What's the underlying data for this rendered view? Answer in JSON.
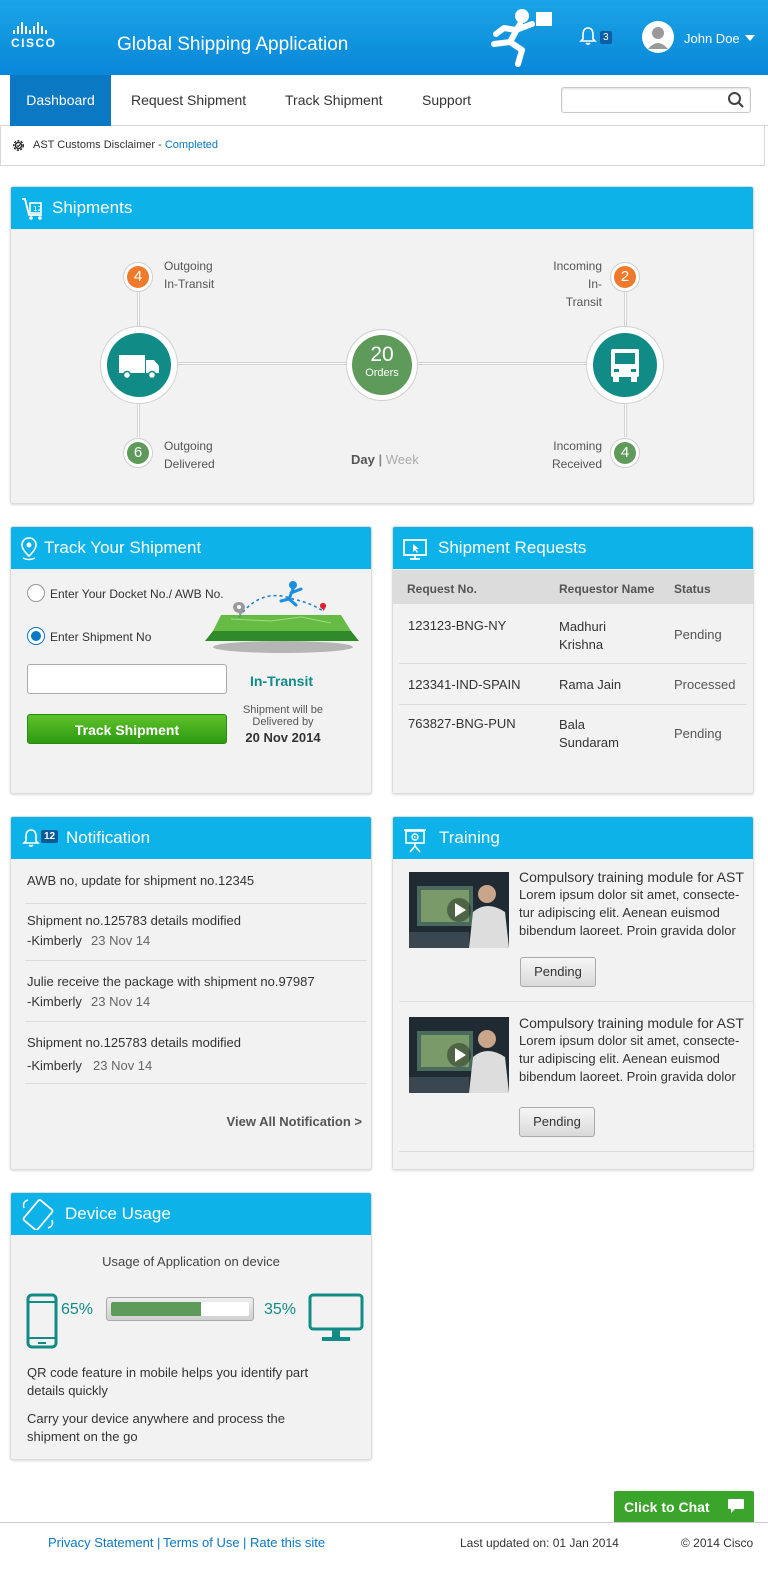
{
  "header": {
    "logo_text": "CISCO",
    "app_title": "Global Shipping Application",
    "notification_count": "3",
    "user_name": "John Doe"
  },
  "nav": {
    "tabs": [
      {
        "label": "Dashboard",
        "active": true
      },
      {
        "label": "Request Shipment",
        "active": false
      },
      {
        "label": "Track Shipment",
        "active": false
      },
      {
        "label": "Support",
        "active": false
      }
    ],
    "search_value": ""
  },
  "disclaimer": {
    "text": "AST Customs Disclaimer - ",
    "status": "Completed"
  },
  "shipments": {
    "title": "Shipments",
    "outgoing_in_transit": {
      "count": "4",
      "label1": "Outgoing",
      "label2": "In-Transit"
    },
    "outgoing_delivered": {
      "count": "6",
      "label1": "Outgoing",
      "label2": "Delivered"
    },
    "incoming_in_transit": {
      "count": "2",
      "label1": "Incoming",
      "label2": "In-Transit"
    },
    "incoming_received": {
      "count": "4",
      "label1": "Incoming",
      "label2": "Received"
    },
    "orders_count": "20",
    "orders_label": "Orders",
    "period_day": "Day",
    "period_sep": "|",
    "period_week": "Week"
  },
  "track": {
    "title": "Track Your Shipment",
    "option1": "Enter Your Docket No./ AWB No.",
    "option2": "Enter Shipment No",
    "selected_option": 2,
    "input_value": "",
    "button": "Track Shipment",
    "status": "In-Transit",
    "delivery_line1": "Shipment will be",
    "delivery_line2": "Delivered by",
    "delivery_date": "20 Nov 2014"
  },
  "requests": {
    "title": "Shipment Requests",
    "columns": [
      "Request No.",
      "Requestor Name",
      "Status"
    ],
    "rows": [
      {
        "no": "123123-BNG-NY",
        "name1": "Madhuri",
        "name2": "Krishna",
        "status": "Pending"
      },
      {
        "no": "123341-IND-SPAIN",
        "name1": "Rama Jain",
        "name2": "",
        "status": "Processed"
      },
      {
        "no": "763827-BNG-PUN",
        "name1": "Bala",
        "name2": "Sundaram",
        "status": "Pending"
      }
    ]
  },
  "notification": {
    "title": "Notification",
    "badge": "12",
    "items": [
      {
        "text": "AWB no, update for shipment no.12345",
        "author": "",
        "date": ""
      },
      {
        "text": "Shipment no.125783 details modified",
        "author": "-Kimberly",
        "date": "23 Nov 14"
      },
      {
        "text": "Julie receive the package with shipment no.97987",
        "author": "-Kimberly",
        "date": "23 Nov 14"
      },
      {
        "text": "Shipment no.125783 details modified",
        "author": "-Kimberly",
        "date": "23 Nov 14"
      }
    ],
    "view_all": "View All Notification >"
  },
  "training": {
    "title": "Training",
    "items": [
      {
        "heading": "Compulsory training module for AST",
        "l1": "Lorem ipsum dolor sit amet, consecte-",
        "l2": "tur adipiscing elit. Aenean euismod",
        "l3": "bibendum laoreet. Proin gravida dolor",
        "button": "Pending"
      },
      {
        "heading": "Compulsory training module for AST",
        "l1": "Lorem ipsum dolor sit amet, consecte-",
        "l2": "tur adipiscing elit. Aenean euismod",
        "l3": "bibendum laoreet. Proin gravida dolor",
        "button": "Pending"
      }
    ]
  },
  "device": {
    "title": "Device Usage",
    "subtitle": "Usage of Application on device",
    "mobile_pct": "65%",
    "desktop_pct": "35%",
    "mobile_fraction": 0.65,
    "tip1_l1": "QR code feature in mobile helps you identify part",
    "tip1_l2": "details quickly",
    "tip2_l1": "Carry your device anywhere and process the",
    "tip2_l2": "shipment on the go"
  },
  "chat": {
    "label": "Click to Chat"
  },
  "footer": {
    "privacy": "Privacy Statement",
    "sep": "|",
    "terms": "Terms of Use",
    "rate": "Rate this site",
    "updated": "Last updated on: 01 Jan 2014",
    "copyright": "© 2014 Cisco"
  },
  "colors": {
    "brand_blue": "#0db3e8",
    "teal": "#118b85",
    "orange": "#f07a2b",
    "green": "#5e9a59"
  }
}
